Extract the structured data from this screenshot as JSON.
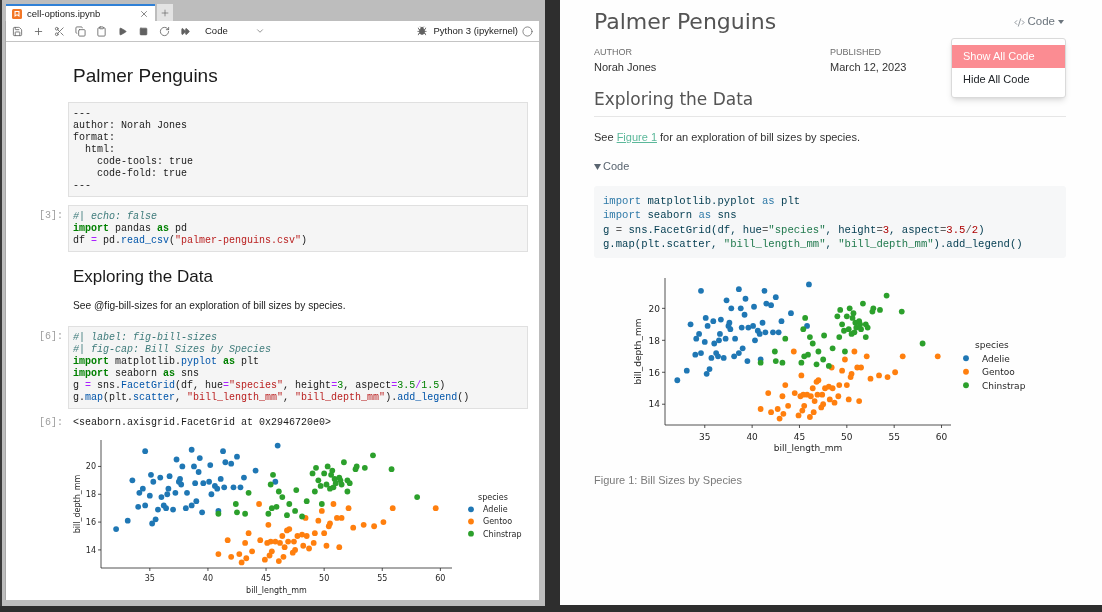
{
  "notebook": {
    "tabs": [
      {
        "label": "cell-options.ipynb",
        "selected": true
      }
    ],
    "toolbar": {
      "cell_type": "Code",
      "kernel": "Python 3 (ipykernel)"
    },
    "cells": [
      {
        "kind": "heading1",
        "text": "Palmer Penguins"
      },
      {
        "kind": "raw",
        "lines": [
          "---",
          "author: Norah Jones",
          "format:",
          "  html:",
          "    code-tools: true",
          "    code-fold: true",
          "---"
        ]
      },
      {
        "kind": "code",
        "prompt": "[3]:",
        "lines": [
          [
            {
              "kind": "comment",
              "text": "#| echo: false"
            }
          ],
          [
            {
              "kind": "keyword",
              "text": "import"
            },
            {
              "kind": "plain",
              "text": " pandas "
            },
            {
              "kind": "keyword",
              "text": "as"
            },
            {
              "kind": "plain",
              "text": " pd"
            }
          ],
          [
            {
              "kind": "plain",
              "text": "df "
            },
            {
              "kind": "operator",
              "text": "="
            },
            {
              "kind": "plain",
              "text": " pd."
            },
            {
              "kind": "func",
              "text": "read_csv"
            },
            {
              "kind": "plain",
              "text": "("
            },
            {
              "kind": "string",
              "text": "\"palmer-penguins.csv\""
            },
            {
              "kind": "plain",
              "text": ")"
            }
          ]
        ]
      },
      {
        "kind": "heading2",
        "text": "Exploring the Data"
      },
      {
        "kind": "paragraph",
        "text": "See @fig-bill-sizes for an exploration of bill sizes by species."
      },
      {
        "kind": "code",
        "prompt": "[6]:",
        "lines": [
          [
            {
              "kind": "comment",
              "text": "#| label: fig-bill-sizes"
            }
          ],
          [
            {
              "kind": "comment",
              "text": "#| fig-cap: Bill Sizes by Species"
            }
          ],
          [
            {
              "kind": "keyword",
              "text": "import"
            },
            {
              "kind": "plain",
              "text": " matplotlib."
            },
            {
              "kind": "func",
              "text": "pyplot"
            },
            {
              "kind": "keyword",
              "text": " as"
            },
            {
              "kind": "plain",
              "text": " plt"
            }
          ],
          [
            {
              "kind": "keyword",
              "text": "import"
            },
            {
              "kind": "plain",
              "text": " seaborn "
            },
            {
              "kind": "keyword",
              "text": "as"
            },
            {
              "kind": "plain",
              "text": " sns"
            }
          ],
          [
            {
              "kind": "plain",
              "text": "g "
            },
            {
              "kind": "operator",
              "text": "="
            },
            {
              "kind": "plain",
              "text": " sns."
            },
            {
              "kind": "func",
              "text": "FacetGrid"
            },
            {
              "kind": "plain",
              "text": "(df, hue"
            },
            {
              "kind": "operator",
              "text": "="
            },
            {
              "kind": "string",
              "text": "\"species\""
            },
            {
              "kind": "plain",
              "text": ", height"
            },
            {
              "kind": "operator",
              "text": "="
            },
            {
              "kind": "number",
              "text": "3"
            },
            {
              "kind": "plain",
              "text": ", aspect"
            },
            {
              "kind": "operator",
              "text": "="
            },
            {
              "kind": "number",
              "text": "3.5"
            },
            {
              "kind": "operator",
              "text": "/"
            },
            {
              "kind": "number",
              "text": "1.5"
            },
            {
              "kind": "plain",
              "text": ")"
            }
          ],
          [
            {
              "kind": "plain",
              "text": "g."
            },
            {
              "kind": "func",
              "text": "map"
            },
            {
              "kind": "plain",
              "text": "(plt."
            },
            {
              "kind": "func",
              "text": "scatter"
            },
            {
              "kind": "plain",
              "text": ", "
            },
            {
              "kind": "string",
              "text": "\"bill_length_mm\""
            },
            {
              "kind": "plain",
              "text": ", "
            },
            {
              "kind": "string",
              "text": "\"bill_depth_mm\""
            },
            {
              "kind": "plain",
              "text": ")."
            },
            {
              "kind": "func",
              "text": "add_legend"
            },
            {
              "kind": "plain",
              "text": "()"
            }
          ]
        ]
      },
      {
        "kind": "output",
        "prompt": "[6]:",
        "text": "<seaborn.axisgrid.FacetGrid at 0x2946720e0>"
      },
      {
        "kind": "figure",
        "chart_data": {
          "type": "scatter",
          "xlabel": "bill_length_mm",
          "ylabel": "bill_depth_mm",
          "legend": "right",
          "legend_title": "species",
          "xlim": [
            30.8,
            61
          ],
          "ylim": [
            12.7,
            21.9
          ],
          "xticks": [
            35,
            40,
            45,
            50,
            55,
            60
          ],
          "yticks": [
            14,
            16,
            18,
            20
          ],
          "series": [
            {
              "name": "Adelie",
              "color": "#1f77b4",
              "x": [
                32.1,
                33.1,
                33.5,
                34.0,
                34.1,
                34.4,
                34.6,
                34.6,
                35.1,
                35.2,
                35.3,
                35.5,
                35.7,
                35.9,
                36.0,
                36.2,
                36.4,
                36.6,
                36.7,
                37.0,
                37.2,
                37.3,
                37.6,
                37.7,
                37.8,
                38.1,
                38.2,
                38.6,
                38.6,
                38.8,
                39.0,
                39.2,
                39.5,
                39.6,
                40.1,
                40.2,
                40.6,
                40.8,
                40.9,
                41.1,
                41.4,
                41.5,
                42.0,
                42.2,
                42.5,
                42.8,
                43.1,
                44.1,
                45.8,
                46.0,
                35.0,
                36.5,
                38.9,
                39.3,
                40.3,
                41.3,
                37.5
              ],
              "values": [
                15.5,
                16.1,
                19.0,
                17.1,
                18.1,
                18.4,
                21.1,
                17.2,
                19.4,
                15.9,
                18.9,
                16.2,
                16.9,
                19.2,
                17.8,
                17.2,
                17.0,
                18.4,
                19.3,
                16.9,
                18.1,
                20.5,
                19.1,
                18.7,
                20.0,
                17.0,
                18.1,
                21.2,
                17.2,
                20.0,
                17.5,
                19.6,
                16.7,
                18.8,
                18.9,
                20.1,
                18.6,
                18.4,
                16.8,
                19.1,
                18.5,
                20.3,
                20.2,
                18.5,
                20.7,
                18.5,
                19.2,
                19.7,
                18.9,
                21.5,
                17.9,
                18.0,
                18.8,
                20.6,
                18.0,
                21.1,
                18.9
              ]
            },
            {
              "name": "Gentoo",
              "color": "#ff7f0e",
              "x": [
                40.9,
                41.7,
                42.0,
                42.7,
                42.9,
                43.2,
                43.3,
                43.5,
                43.8,
                44.4,
                44.5,
                44.9,
                45.1,
                45.2,
                45.3,
                45.4,
                45.5,
                45.8,
                46.1,
                46.2,
                46.4,
                46.5,
                46.6,
                46.8,
                47.0,
                47.3,
                47.5,
                47.7,
                48.1,
                48.2,
                48.5,
                48.7,
                49.1,
                49.2,
                49.5,
                49.8,
                50.0,
                50.2,
                50.4,
                50.5,
                50.8,
                51.1,
                51.3,
                51.5,
                52.1,
                52.5,
                53.4,
                54.3,
                55.1,
                55.9,
                59.6,
                48.4,
                47.4,
                46.9
              ],
              "values": [
                13.7,
                14.7,
                13.5,
                13.7,
                13.1,
                14.5,
                13.4,
                15.2,
                13.9,
                17.3,
                14.7,
                13.3,
                14.5,
                15.8,
                13.6,
                14.6,
                13.9,
                14.6,
                13.2,
                14.5,
                15.0,
                13.5,
                14.2,
                15.4,
                15.5,
                13.8,
                14.0,
                15.0,
                15.1,
                14.3,
                15.0,
                14.1,
                14.5,
                15.2,
                16.1,
                16.8,
                15.2,
                14.3,
                15.7,
                15.9,
                17.3,
                16.3,
                14.2,
                16.3,
                17.0,
                15.6,
                15.8,
                15.7,
                16.0,
                17.0,
                17.0,
                16.3,
                14.6,
                14.6
              ]
            },
            {
              "name": "Chinstrap",
              "color": "#2ca02c",
              "x": [
                40.9,
                42.4,
                42.5,
                43.2,
                43.5,
                45.2,
                45.4,
                45.5,
                45.6,
                45.9,
                46.1,
                46.4,
                46.8,
                47.0,
                47.5,
                47.6,
                48.1,
                48.5,
                49.0,
                49.2,
                49.3,
                49.5,
                49.7,
                49.8,
                50.0,
                50.2,
                50.3,
                50.5,
                50.6,
                50.7,
                50.8,
                50.9,
                51.0,
                51.3,
                51.4,
                51.5,
                51.7,
                52.0,
                52.0,
                52.2,
                52.7,
                52.8,
                53.5,
                54.2,
                55.8,
                58.0
              ],
              "values": [
                16.6,
                17.3,
                16.7,
                16.6,
                18.1,
                16.6,
                18.7,
                17.0,
                19.4,
                17.1,
                18.2,
                17.8,
                16.5,
                17.3,
                16.8,
                18.3,
                16.4,
                17.5,
                19.5,
                18.2,
                19.9,
                19.0,
                18.6,
                17.3,
                19.5,
                18.7,
                20.0,
                18.4,
                19.4,
                19.7,
                18.5,
                19.1,
                18.8,
                19.2,
                19.0,
                18.7,
                20.3,
                18.2,
                19.0,
                18.8,
                19.8,
                20.0,
                19.9,
                20.8,
                19.8,
                17.8
              ]
            }
          ]
        }
      }
    ]
  },
  "rendered": {
    "title": "Palmer Penguins",
    "code_tools": {
      "label": "Code",
      "expanded": true,
      "menu": [
        {
          "label": "Show All Code",
          "selected": true
        },
        {
          "label": "Hide All Code",
          "selected": false
        }
      ]
    },
    "meta": [
      {
        "label": "AUTHOR",
        "value": "Norah Jones"
      },
      {
        "label": "PUBLISHED",
        "value": "March 12, 2023"
      }
    ],
    "heading": "Exploring the Data",
    "paragraph": {
      "before": "See ",
      "link": "Figure 1",
      "after": " for an exploration of bill sizes by species."
    },
    "code_fold": {
      "label": "Code",
      "expanded": true,
      "lines": [
        [
          {
            "kind": "keyword",
            "text": "import"
          },
          {
            "kind": "plain",
            "text": " matplotlib.pyplot "
          },
          {
            "kind": "keyword",
            "text": "as"
          },
          {
            "kind": "plain",
            "text": " plt"
          }
        ],
        [
          {
            "kind": "keyword",
            "text": "import"
          },
          {
            "kind": "plain",
            "text": " seaborn "
          },
          {
            "kind": "keyword",
            "text": "as"
          },
          {
            "kind": "plain",
            "text": " sns"
          }
        ],
        [
          {
            "kind": "plain",
            "text": "g "
          },
          {
            "kind": "operator",
            "text": "="
          },
          {
            "kind": "plain",
            "text": " sns.FacetGrid(df, hue"
          },
          {
            "kind": "operator",
            "text": "="
          },
          {
            "kind": "string",
            "text": "\"species\""
          },
          {
            "kind": "plain",
            "text": ", height"
          },
          {
            "kind": "operator",
            "text": "="
          },
          {
            "kind": "number",
            "text": "3"
          },
          {
            "kind": "plain",
            "text": ", aspect"
          },
          {
            "kind": "operator",
            "text": "="
          },
          {
            "kind": "number",
            "text": "3.5"
          },
          {
            "kind": "operator",
            "text": "/"
          },
          {
            "kind": "number",
            "text": "2"
          },
          {
            "kind": "plain",
            "text": ")"
          }
        ],
        [
          {
            "kind": "plain",
            "text": "g.map(plt.scatter, "
          },
          {
            "kind": "string",
            "text": "\"bill_length_mm\""
          },
          {
            "kind": "plain",
            "text": ", "
          },
          {
            "kind": "string",
            "text": "\"bill_depth_mm\""
          },
          {
            "kind": "plain",
            "text": ").add_legend()"
          }
        ]
      ]
    },
    "figure": {
      "caption": "Figure 1: Bill Sizes by Species",
      "chart_data": {
        "type": "scatter",
        "xlabel": "bill_length_mm",
        "ylabel": "bill_depth_mm",
        "legend": "right",
        "legend_title": "species",
        "xlim": [
          30.8,
          61
        ],
        "ylim": [
          12.7,
          21.9
        ],
        "xticks": [
          35,
          40,
          45,
          50,
          55,
          60
        ],
        "yticks": [
          14,
          16,
          18,
          20
        ],
        "series": [
          {
            "name": "Adelie",
            "color": "#1f77b4",
            "x": [
              32.1,
              33.1,
              33.5,
              34.0,
              34.1,
              34.4,
              34.6,
              34.6,
              35.1,
              35.2,
              35.3,
              35.5,
              35.7,
              35.9,
              36.0,
              36.2,
              36.4,
              36.6,
              36.7,
              37.0,
              37.2,
              37.3,
              37.6,
              37.7,
              37.8,
              38.1,
              38.2,
              38.6,
              38.6,
              38.8,
              39.0,
              39.2,
              39.5,
              39.6,
              40.1,
              40.2,
              40.6,
              40.8,
              40.9,
              41.1,
              41.4,
              41.5,
              42.0,
              42.2,
              42.5,
              42.8,
              43.1,
              44.1,
              45.8,
              46.0,
              35.0,
              36.5,
              38.9,
              39.3,
              40.3,
              41.3,
              37.5
            ],
            "values": [
              15.5,
              16.1,
              19.0,
              17.1,
              18.1,
              18.4,
              21.1,
              17.2,
              19.4,
              15.9,
              18.9,
              16.2,
              16.9,
              19.2,
              17.8,
              17.2,
              17.0,
              18.4,
              19.3,
              16.9,
              18.1,
              20.5,
              19.1,
              18.7,
              20.0,
              17.0,
              18.1,
              21.2,
              17.2,
              20.0,
              17.5,
              19.6,
              16.7,
              18.8,
              18.9,
              20.1,
              18.6,
              18.4,
              16.8,
              19.1,
              18.5,
              20.3,
              20.2,
              18.5,
              20.7,
              18.5,
              19.2,
              19.7,
              18.9,
              21.5,
              17.9,
              18.0,
              18.8,
              20.6,
              18.0,
              21.1,
              18.9
            ]
          },
          {
            "name": "Gentoo",
            "color": "#ff7f0e",
            "x": [
              40.9,
              41.7,
              42.0,
              42.7,
              42.9,
              43.2,
              43.3,
              43.5,
              43.8,
              44.4,
              44.5,
              44.9,
              45.1,
              45.2,
              45.3,
              45.4,
              45.5,
              45.8,
              46.1,
              46.2,
              46.4,
              46.5,
              46.6,
              46.8,
              47.0,
              47.3,
              47.5,
              47.7,
              48.1,
              48.2,
              48.5,
              48.7,
              49.1,
              49.2,
              49.5,
              49.8,
              50.0,
              50.2,
              50.4,
              50.5,
              50.8,
              51.1,
              51.3,
              51.5,
              52.1,
              52.5,
              53.4,
              54.3,
              55.1,
              55.9,
              59.6,
              48.4,
              47.4,
              46.9
            ],
            "values": [
              13.7,
              14.7,
              13.5,
              13.7,
              13.1,
              14.5,
              13.4,
              15.2,
              13.9,
              17.3,
              14.7,
              13.3,
              14.5,
              15.8,
              13.6,
              14.6,
              13.9,
              14.6,
              13.2,
              14.5,
              15.0,
              13.5,
              14.2,
              15.4,
              15.5,
              13.8,
              14.0,
              15.0,
              15.1,
              14.3,
              15.0,
              14.1,
              14.5,
              15.2,
              16.1,
              16.8,
              15.2,
              14.3,
              15.7,
              15.9,
              17.3,
              16.3,
              14.2,
              16.3,
              17.0,
              15.6,
              15.8,
              15.7,
              16.0,
              17.0,
              17.0,
              16.3,
              14.6,
              14.6
            ]
          },
          {
            "name": "Chinstrap",
            "color": "#2ca02c",
            "x": [
              40.9,
              42.4,
              42.5,
              43.2,
              43.5,
              45.2,
              45.4,
              45.5,
              45.6,
              45.9,
              46.1,
              46.4,
              46.8,
              47.0,
              47.5,
              47.6,
              48.1,
              48.5,
              49.0,
              49.2,
              49.3,
              49.5,
              49.7,
              49.8,
              50.0,
              50.2,
              50.3,
              50.5,
              50.6,
              50.7,
              50.8,
              50.9,
              51.0,
              51.3,
              51.4,
              51.5,
              51.7,
              52.0,
              52.0,
              52.2,
              52.7,
              52.8,
              53.5,
              54.2,
              55.8,
              58.0
            ],
            "values": [
              16.6,
              17.3,
              16.7,
              16.6,
              18.1,
              16.6,
              18.7,
              17.0,
              19.4,
              17.1,
              18.2,
              17.8,
              16.5,
              17.3,
              16.8,
              18.3,
              16.4,
              17.5,
              19.5,
              18.2,
              19.9,
              19.0,
              18.6,
              17.3,
              19.5,
              18.7,
              20.0,
              18.4,
              19.4,
              19.7,
              18.5,
              19.1,
              18.8,
              19.2,
              19.0,
              18.7,
              20.3,
              18.2,
              19.0,
              18.8,
              19.8,
              20.0,
              19.9,
              20.8,
              19.8,
              17.8
            ]
          }
        ]
      }
    }
  }
}
